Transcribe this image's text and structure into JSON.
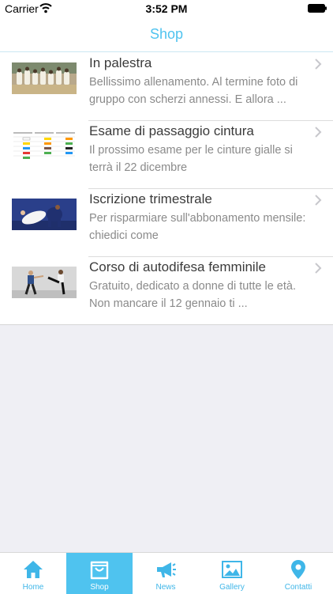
{
  "status_bar": {
    "carrier": "Carrier",
    "time": "3:52 PM"
  },
  "nav": {
    "title": "Shop"
  },
  "items": [
    {
      "title": "In palestra",
      "description": "Bellissimo allenamento. Al termine foto di gruppo con scherzi annessi. E allora ..."
    },
    {
      "title": "Esame di passaggio cintura",
      "description": "Il prossimo esame per le cinture gialle si terrà il 22 dicembre"
    },
    {
      "title": "Iscrizione trimestrale",
      "description": "Per risparmiare sull'abbonamento mensile: chiedici come"
    },
    {
      "title": "Corso di autodifesa femminile",
      "description": "Gratuito, dedicato a donne di tutte le età. Non mancare il 12 gennaio ti ..."
    }
  ],
  "tabs": [
    {
      "label": "Home",
      "icon": "home-icon"
    },
    {
      "label": "Shop",
      "icon": "bag-icon",
      "active": true
    },
    {
      "label": "News",
      "icon": "megaphone-icon"
    },
    {
      "label": "Gallery",
      "icon": "picture-icon"
    },
    {
      "label": "Contatti",
      "icon": "location-pin-icon"
    }
  ],
  "colors": {
    "accent": "#4fc3ef",
    "title_text": "#3b3b3b",
    "description_text": "#8a8a8a",
    "background": "#efeff4"
  }
}
